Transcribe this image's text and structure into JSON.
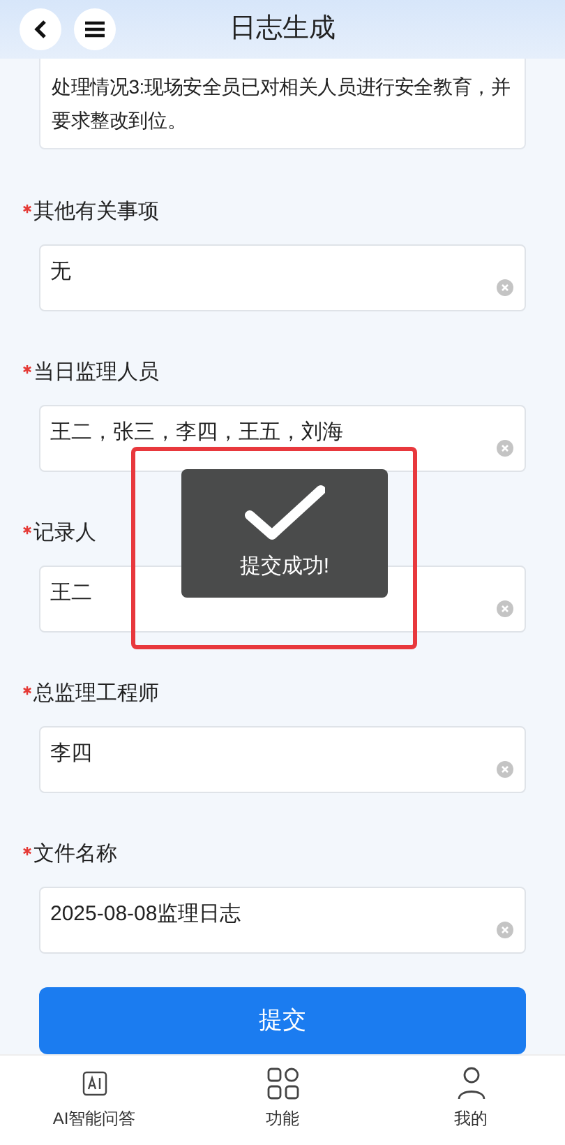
{
  "header": {
    "title": "日志生成"
  },
  "notes_field": {
    "value": "处理情况3:现场安全员已对相关人员进行安全教育，并要求整改到位。"
  },
  "fields": [
    {
      "label": "其他有关事项",
      "required": true,
      "value": "无"
    },
    {
      "label": "当日监理人员",
      "required": true,
      "value": "王二，张三，李四，王五，刘海"
    },
    {
      "label": "记录人",
      "required": true,
      "value": "王二"
    },
    {
      "label": "总监理工程师",
      "required": true,
      "value": "李四"
    },
    {
      "label": "文件名称",
      "required": true,
      "value": "2025-08-08监理日志"
    }
  ],
  "submit_button": {
    "label": "提交"
  },
  "toast": {
    "message": "提交成功!",
    "highlighted": true
  },
  "tab_bar": [
    {
      "kind": "ai",
      "label": "AI智能问答"
    },
    {
      "kind": "grid",
      "label": "功能"
    },
    {
      "kind": "person",
      "label": "我的"
    }
  ]
}
